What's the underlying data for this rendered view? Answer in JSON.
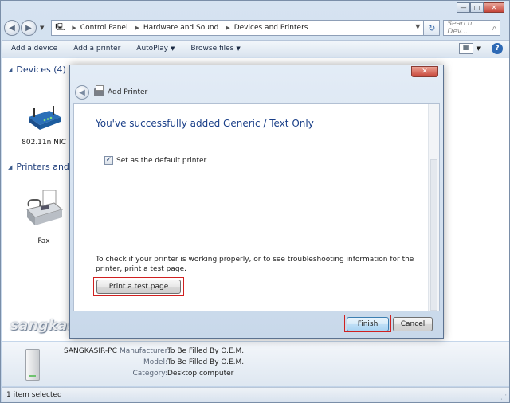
{
  "window": {
    "caption_buttons": {
      "minimize": "—",
      "maximize": "□",
      "close": "✕"
    }
  },
  "address_bar": {
    "crumbs": [
      "Control Panel",
      "Hardware and Sound",
      "Devices and Printers"
    ],
    "search_placeholder": "Search Dev..."
  },
  "command_bar": {
    "items": [
      {
        "label": "Add a device",
        "has_dropdown": false
      },
      {
        "label": "Add a printer",
        "has_dropdown": false
      },
      {
        "label": "AutoPlay",
        "has_dropdown": true
      },
      {
        "label": "Browse files",
        "has_dropdown": true
      }
    ],
    "help": "?"
  },
  "groups": {
    "devices": {
      "title": "Devices (4)"
    },
    "printers": {
      "title": "Printers and"
    }
  },
  "devices": [
    {
      "label": "802.11n NIC",
      "icon": "router-icon"
    },
    {
      "label": "Fax",
      "icon": "fax-icon"
    }
  ],
  "dialog": {
    "title": "Add Printer",
    "close": "✕",
    "success_message": "You've successfully added Generic / Text Only",
    "default_printer_label": "Set as the default printer",
    "default_printer_checked": true,
    "info_text": "To check if your printer is working properly, or to see troubleshooting information for the printer, print a test page.",
    "test_page_button": "Print a test page",
    "finish_button": "Finish",
    "cancel_button": "Cancel"
  },
  "watermark": "sangkasir solutions",
  "details": {
    "computer_name": "SANGKASIR-PC",
    "fields": [
      {
        "key": "Manufacturer:",
        "value": "To Be Filled By O.E.M."
      },
      {
        "key": "Model:",
        "value": "To Be Filled By O.E.M."
      },
      {
        "key": "Category:",
        "value": "Desktop computer"
      }
    ]
  },
  "status_bar": {
    "text": "1 item selected"
  },
  "colors": {
    "heading_blue": "#1a3f88",
    "highlight_red": "#d02020",
    "window_frame": "#c2d4e9"
  }
}
